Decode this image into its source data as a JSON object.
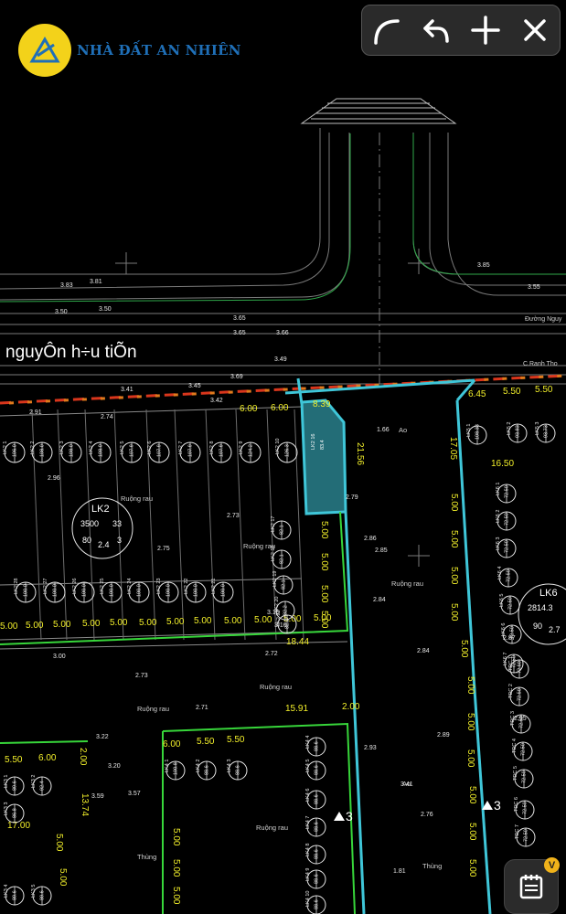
{
  "app": {
    "brand": "NHÀ ĐẤT AN NHIÊN",
    "logo_icon": "a-triangle-logo"
  },
  "toolbar": {
    "buttons": [
      {
        "name": "curve-icon",
        "label": "curve"
      },
      {
        "name": "undo-icon",
        "label": "undo"
      },
      {
        "name": "plus-icon",
        "label": "add"
      },
      {
        "name": "close-icon",
        "label": "close"
      }
    ]
  },
  "fab": {
    "icon": "notepad-icon",
    "badge": "V",
    "badge_color": "#f0b21a"
  },
  "map": {
    "street_name": "nguyÔn h÷u tiÕn",
    "street_small": "Đường Nguy",
    "street_small2": "C.Ranh Tho",
    "road_labels": [
      "3.83",
      "3.81",
      "3.50",
      "3.50",
      "3.65",
      "3.66",
      "3.65",
      "3.85",
      "3.55",
      "3.49",
      "3.45",
      "3.69",
      "3.41",
      "3.42"
    ],
    "dims_top": [
      "6.00",
      "6.00",
      "8.39",
      "6.45",
      "5.50",
      "5.50"
    ],
    "dims_bottom": [
      "5.00",
      "5.00",
      "5.00",
      "5.00",
      "5.00",
      "5.00",
      "5.00",
      "5.00",
      "5.00",
      "5.00",
      "5.00",
      "5.00"
    ],
    "dims_mid": [
      "18.44",
      "15.91",
      "2.00",
      "17.05",
      "21.56",
      "16.50",
      "13.74",
      "17.00",
      "2.00"
    ],
    "dims_lower": [
      "6.00",
      "5.50",
      "5.50",
      "5.50",
      "6.00"
    ],
    "blocks": [
      {
        "label": "LK2",
        "v1": "3500",
        "v2": "33",
        "v3": "80",
        "v4": "2.4",
        "v5": "3"
      },
      {
        "label": "LK6",
        "v1": "2814.3",
        "v2": "90",
        "v3": "2.7",
        "v4": ""
      }
    ],
    "texts": [
      "Ruộng rau",
      "Ruộng rau",
      "Ruộng rau",
      "Ruộng rau",
      "Ruộng rau",
      "Ruộng rau",
      "Thùng",
      "Thùng",
      "Ao",
      "Ao"
    ],
    "elev": [
      "2.91",
      "2.74",
      "2.96",
      "2.75",
      "2.73",
      "2.86",
      "2.84",
      "2.85",
      "2.79",
      "2.72",
      "2.73",
      "2.71",
      "2.89",
      "2.76",
      "2.84",
      "3.00",
      "3.16",
      "3.22",
      "3.20",
      "3.57",
      "3.59",
      "3.41",
      "2.93",
      "2.87",
      "2.95",
      "1.66",
      "1.81",
      "3.15"
    ],
    "arrow_marks": [
      "3",
      "3"
    ],
    "lot_selected": {
      "code": "LK2 16",
      "area": "83.4"
    },
    "lots_row1": [
      {
        "c": "LK2 1",
        "a": "106.0"
      },
      {
        "c": "LK2 2",
        "a": "108.0"
      },
      {
        "c": "LK2 3",
        "a": "108.0"
      },
      {
        "c": "LK2 4",
        "a": "108.0"
      },
      {
        "c": "LK2 5",
        "a": "107.9"
      },
      {
        "c": "LK2 6",
        "a": "107.9"
      },
      {
        "c": "LK2 7",
        "a": "107.9"
      },
      {
        "c": "LK2 8",
        "a": "107.9"
      },
      {
        "c": "LK2 9",
        "a": "124.2"
      },
      {
        "c": "LK2 10",
        "a": "126.3"
      }
    ],
    "lots_row2": [
      {
        "c": "LK2 28",
        "a": "100.0"
      },
      {
        "c": "LK2 27",
        "a": "100.0"
      },
      {
        "c": "LK2 26",
        "a": "100.0"
      },
      {
        "c": "LK2 25",
        "a": "100.0"
      },
      {
        "c": "LK2 24",
        "a": "100.0"
      },
      {
        "c": "LK2 23",
        "a": "100.0"
      },
      {
        "c": "LK2 22",
        "a": "100.0"
      },
      {
        "c": "LK2 21",
        "a": "100.0"
      }
    ],
    "lots_col_mid": [
      {
        "c": "LK2 17",
        "a": "82.1"
      },
      {
        "c": "LK2 18",
        "a": "82.1"
      },
      {
        "c": "LK2 19",
        "a": "82.1"
      },
      {
        "c": "LK2 20",
        "a": "82.2"
      },
      {
        "c": "LK2 21",
        "a": "82.2"
      }
    ],
    "lots_right": [
      {
        "c": "LK5 1",
        "a": "108.33"
      },
      {
        "c": "LK5 2",
        "a": "93.83"
      },
      {
        "c": "LK5 3",
        "a": "93.73"
      },
      {
        "c": "LK6 1",
        "a": "72.50"
      },
      {
        "c": "LK6 2",
        "a": "72.50"
      },
      {
        "c": "LK6 3",
        "a": "72.50"
      },
      {
        "c": "LK6 4",
        "a": "72.50"
      },
      {
        "c": "LK6 5",
        "a": "72.50"
      },
      {
        "c": "LK6 6",
        "a": "72.50"
      },
      {
        "c": "LK6 7",
        "a": "72.50"
      }
    ],
    "lots_right2": [
      {
        "c": "TDC 1",
        "a": "72.50"
      },
      {
        "c": "TDC 2",
        "a": "72.50"
      },
      {
        "c": "TDC 3",
        "a": "72.50"
      },
      {
        "c": "TDC 4",
        "a": "72.50"
      },
      {
        "c": "TDC 5",
        "a": "72.50"
      },
      {
        "c": "TDC 6",
        "a": "72.50"
      },
      {
        "c": "TDC 7",
        "a": "72.50"
      }
    ],
    "lots_lower": [
      {
        "c": "LK4 1",
        "a": "100.8"
      },
      {
        "c": "LK4 2",
        "a": "88.6"
      },
      {
        "c": "LK4 3",
        "a": "88.6"
      },
      {
        "c": "LK4 4",
        "a": "88.6"
      },
      {
        "c": "LK4 5",
        "a": "88.6"
      },
      {
        "c": "LK4 6",
        "a": "88.6"
      },
      {
        "c": "LK4 7",
        "a": "88.6"
      },
      {
        "c": "LK4 8",
        "a": "88.6"
      },
      {
        "c": "LK4 9",
        "a": "88.6"
      },
      {
        "c": "LK4 10",
        "a": "88.6"
      }
    ],
    "lots_left": [
      {
        "c": "LK3 1",
        "a": "89.6"
      },
      {
        "c": "LK3 2",
        "a": "92.4"
      },
      {
        "c": "LK3 3",
        "a": "86.8"
      },
      {
        "c": "LK3 4",
        "a": "89.6"
      },
      {
        "c": "LK3 5",
        "a": "89.6"
      }
    ],
    "colors": {
      "lot_highlight": "#3fc6d8",
      "boundary_red": "#d9361c",
      "boundary_orange": "#e07a1c",
      "dim_yellow": "#f2ef2a",
      "block_green": "#37d63a",
      "text_white": "#ffffff"
    }
  }
}
